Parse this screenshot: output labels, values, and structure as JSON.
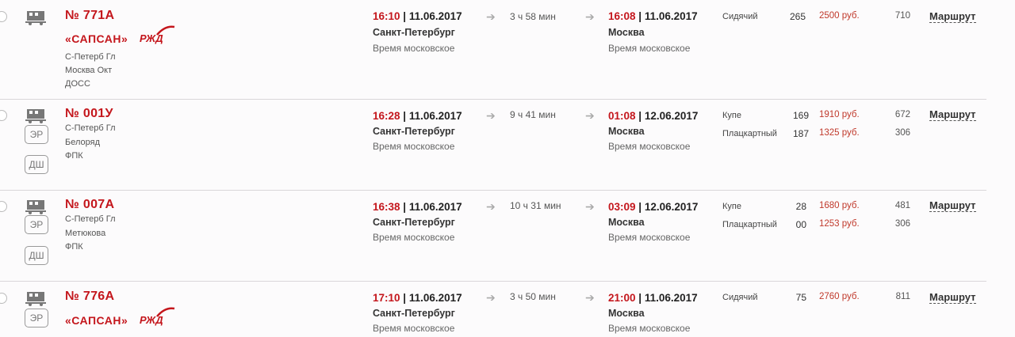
{
  "rows": [
    {
      "number": "№ 771А",
      "brand": "«САПСАН»",
      "rzd": "РЖД",
      "info": [
        "С-Петерб Гл",
        "Москва Окт",
        "ДОСС"
      ],
      "badges": [],
      "departure": {
        "time": "16:10",
        "date": "11.06.2017",
        "city": "Санкт-Петербург",
        "tz": "Время московское"
      },
      "duration": "3 ч 58 мин",
      "arrival": {
        "time": "16:08",
        "date": "11.06.2017",
        "city": "Москва",
        "tz": "Время московское"
      },
      "classes": [
        {
          "name": "Сидячий",
          "seats": "265",
          "price": "2500 руб.",
          "points": "710"
        }
      ],
      "route": "Маршрут"
    },
    {
      "number": "№ 001У",
      "brand": "",
      "rzd": "",
      "info": [
        "С-Петерб Гл",
        "Белоряд",
        "ФПК"
      ],
      "badges": [
        "ЭР",
        "ДШ"
      ],
      "departure": {
        "time": "16:28",
        "date": "11.06.2017",
        "city": "Санкт-Петербург",
        "tz": "Время московское"
      },
      "duration": "9 ч 41 мин",
      "arrival": {
        "time": "01:08",
        "date": "12.06.2017",
        "city": "Москва",
        "tz": "Время московское"
      },
      "classes": [
        {
          "name": "Купе",
          "seats": "169",
          "price": "1910 руб.",
          "points": "672"
        },
        {
          "name": "Плацкартный",
          "seats": "187",
          "price": "1325 руб.",
          "points": "306"
        }
      ],
      "route": "Маршрут"
    },
    {
      "number": "№ 007А",
      "brand": "",
      "rzd": "",
      "info": [
        "С-Петерб Гл",
        "Метюкова",
        "ФПК"
      ],
      "badges": [
        "ЭР",
        "ДШ"
      ],
      "departure": {
        "time": "16:38",
        "date": "11.06.2017",
        "city": "Санкт-Петербург",
        "tz": "Время московское"
      },
      "duration": "10 ч 31 мин",
      "arrival": {
        "time": "03:09",
        "date": "12.06.2017",
        "city": "Москва",
        "tz": "Время московское"
      },
      "classes": [
        {
          "name": "Купе",
          "seats": "28",
          "price": "1680 руб.",
          "points": "481"
        },
        {
          "name": "Плацкартный",
          "seats": "00",
          "price": "1253 руб.",
          "points": "306"
        }
      ],
      "route": "Маршрут"
    },
    {
      "number": "№ 776А",
      "brand": "«САПСАН»",
      "rzd": "РЖД",
      "info": [],
      "badges": [
        "ЭР"
      ],
      "departure": {
        "time": "17:10",
        "date": "11.06.2017",
        "city": "Санкт-Петербург",
        "tz": "Время московское"
      },
      "duration": "3 ч 50 мин",
      "arrival": {
        "time": "21:00",
        "date": "11.06.2017",
        "city": "Москва",
        "tz": "Время московское"
      },
      "classes": [
        {
          "name": "Сидячий",
          "seats": "75",
          "price": "2760 руб.",
          "points": "811"
        }
      ],
      "route": "Маршрут"
    }
  ],
  "icons": {
    "train": "train-icon",
    "radio": "radio-button",
    "arrow": "arrow-right-icon"
  }
}
